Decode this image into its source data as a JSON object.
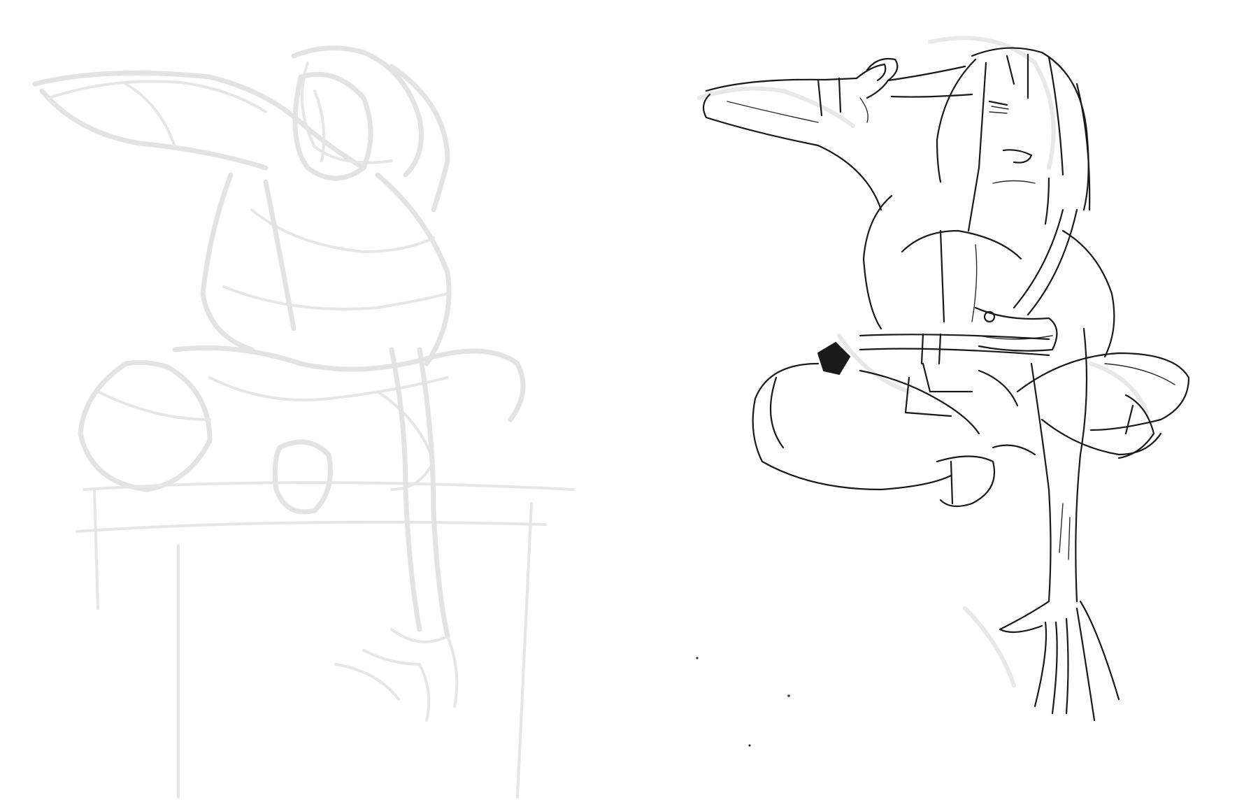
{
  "canvas": {
    "background": "#ffffff",
    "rough_stroke_color": "#e3e3e3",
    "ink_stroke_color": "#1a1a1a"
  },
  "sketches": [
    {
      "name": "rough-gesture-sketch",
      "style": "light gray construction lines"
    },
    {
      "name": "lineart-sketch",
      "style": "black ink line art"
    }
  ]
}
